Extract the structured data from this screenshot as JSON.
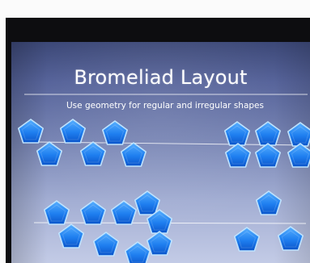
{
  "slide": {
    "title": "Bromeliad Layout",
    "subtitle": "Use geometry for regular and irregular shapes"
  },
  "colors": {
    "slide_top": "#3c4877",
    "slide_bottom": "#c3cbe6",
    "pentagon_fill": "#1f7ff0",
    "pentagon_edge": "#bfe3ff"
  }
}
